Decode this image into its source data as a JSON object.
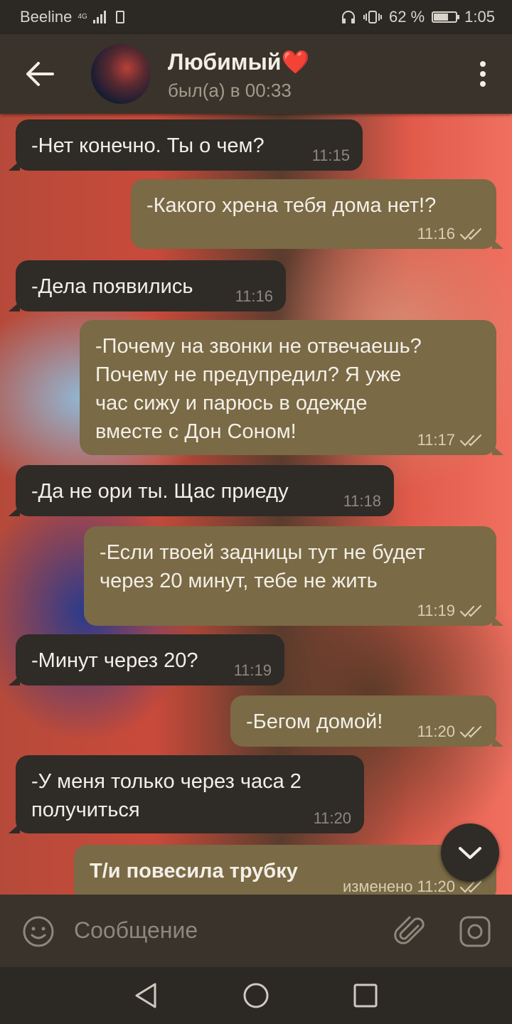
{
  "status_bar": {
    "carrier": "Beeline",
    "network": "4G",
    "battery_percent": "62 %",
    "time": "1:05"
  },
  "header": {
    "contact_name": "Любимый❤️",
    "last_seen": "был(а) в 00:33"
  },
  "messages": [
    {
      "direction": "in",
      "text": "-Нет конечно. Ты о чем?",
      "time": "11:15"
    },
    {
      "direction": "out",
      "text": "-Какого хрена тебя дома нет!?",
      "time": "11:16"
    },
    {
      "direction": "in",
      "text": "-Дела появились",
      "time": "11:16"
    },
    {
      "direction": "out",
      "text": "-Почему на звонки не отвечаешь?\nПочему не предупредил? Я уже\nчас сижу и парюсь в одежде\nвместе с Дон Соном!",
      "time": "11:17"
    },
    {
      "direction": "in",
      "text": "-Да не ори ты. Щас приеду",
      "time": "11:18"
    },
    {
      "direction": "out",
      "text": "-Если твоей задницы тут не будет\nчерез 20 минут, тебе не жить",
      "time": "11:19"
    },
    {
      "direction": "in",
      "text": "-Минут через 20?",
      "time": "11:19"
    },
    {
      "direction": "out",
      "text": "-Бегом домой!",
      "time": "11:20"
    },
    {
      "direction": "in",
      "text": "-У меня только через часа 2\nполучиться",
      "time": "11:20"
    },
    {
      "direction": "out",
      "text": "Т/и повесила трубку",
      "time": "изменено 11:20"
    }
  ],
  "input": {
    "placeholder": "Сообщение"
  },
  "icons": {
    "back": "arrow-left-icon",
    "menu": "more-vert-icon",
    "emoji": "emoji-icon",
    "attach": "paperclip-icon",
    "camera": "camera-icon",
    "scroll_down": "chevron-down-icon"
  },
  "colors": {
    "incoming_bubble": "#2f2b27",
    "outgoing_bubble": "#7a6a45",
    "header": "#3a332b"
  }
}
